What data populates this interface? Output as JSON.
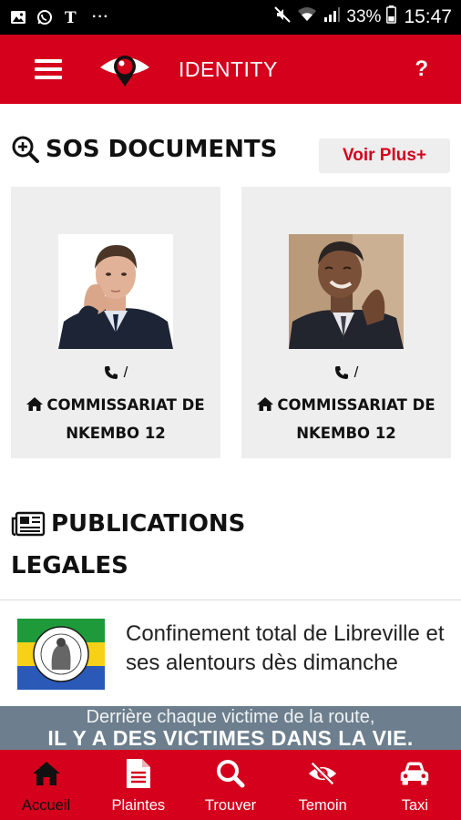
{
  "status_bar": {
    "left_icons": [
      "image-icon",
      "whatsapp-icon",
      "nyt-icon"
    ],
    "dots": "···",
    "battery": "33%",
    "time": "15:47"
  },
  "app_bar": {
    "title": "IDENTITY",
    "help": "?"
  },
  "documents": {
    "title": "SOS DOCUMENTS",
    "more_button": "Voir Plus+",
    "cards": [
      {
        "phone": "/",
        "station": "COMMISSARIAT DE NKEMBO 12"
      },
      {
        "phone": "/",
        "station": "COMMISSARIAT DE NKEMBO 12"
      }
    ]
  },
  "publications": {
    "title_line1": "PUBLICATIONS",
    "title_line2": "LEGALES",
    "items": [
      {
        "text": "Confinement total de Libreville et ses alentours dès dimanche"
      }
    ]
  },
  "banner": {
    "line1": "Derrière chaque victime de la route,",
    "line2": "IL Y A DES VICTIMES DANS LA VIE."
  },
  "bottom_nav": [
    {
      "label": "Accueil",
      "icon": "home-icon",
      "active": true
    },
    {
      "label": "Plaintes",
      "icon": "document-icon",
      "active": false
    },
    {
      "label": "Trouver",
      "icon": "search-icon",
      "active": false
    },
    {
      "label": "Temoin",
      "icon": "eye-slash-icon",
      "active": false
    },
    {
      "label": "Taxi",
      "icon": "car-icon",
      "active": false
    }
  ],
  "colors": {
    "primary_red": "#d4001c",
    "card_grey": "#eeeeee",
    "status_black": "#000000"
  }
}
